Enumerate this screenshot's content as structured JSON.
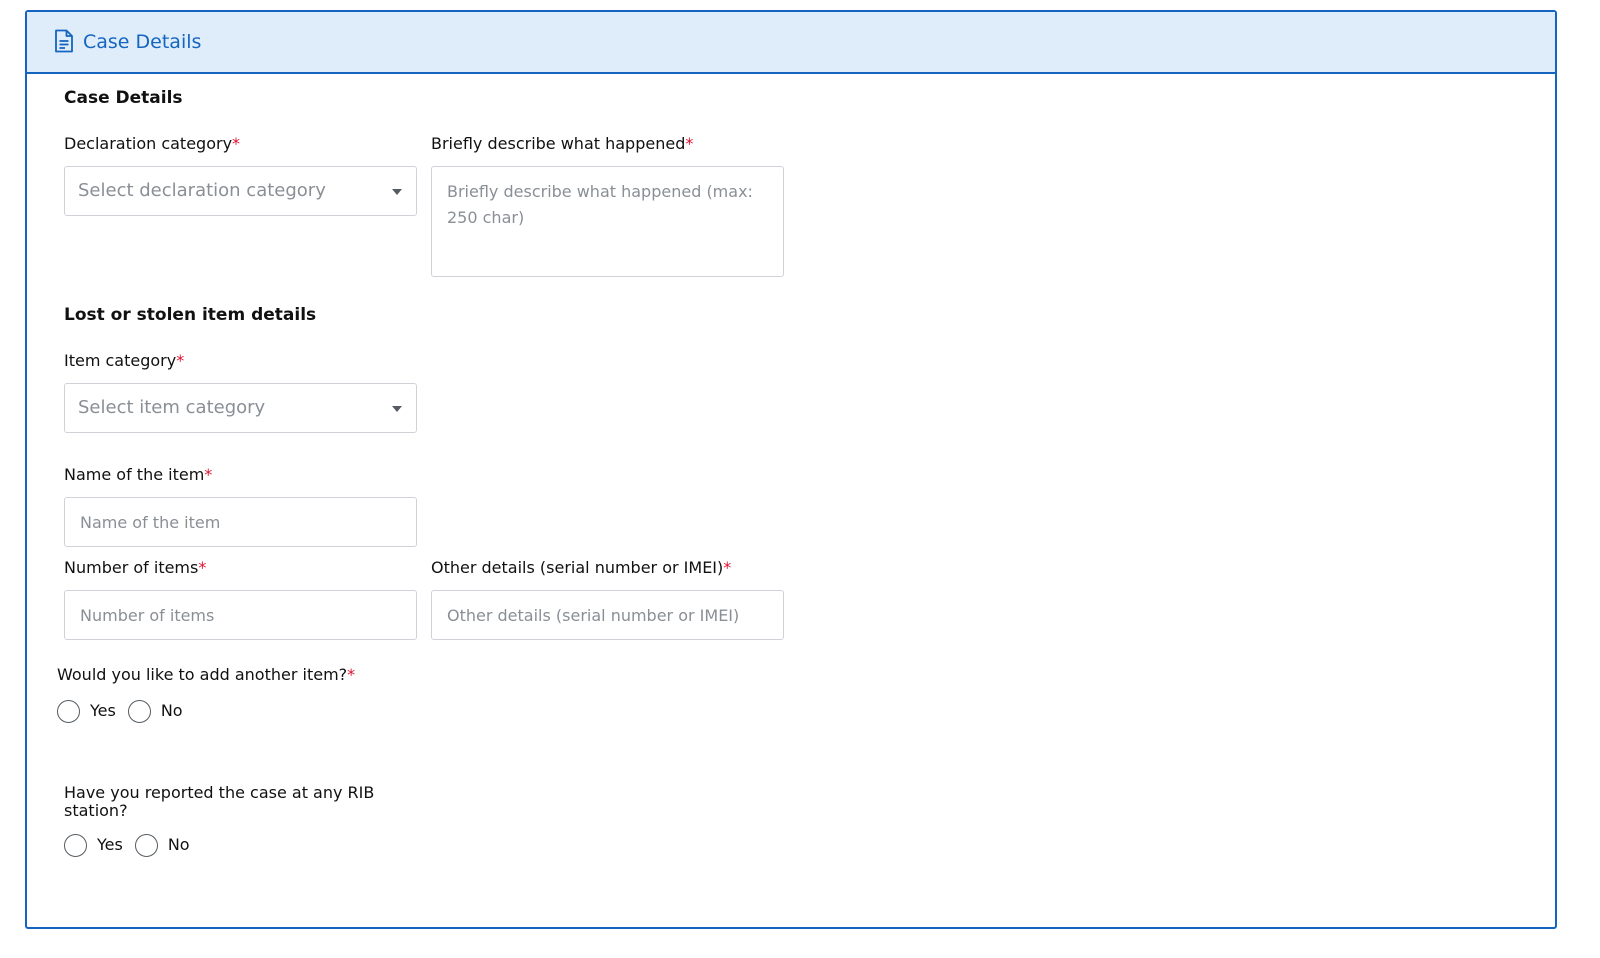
{
  "panel": {
    "header_title": "Case Details",
    "header_icon": "document-icon",
    "accent_color": "#1565c0"
  },
  "case_details": {
    "section_title": "Case Details",
    "declaration_category": {
      "label": "Declaration category",
      "required_mark": "*",
      "placeholder": "Select declaration category"
    },
    "description": {
      "label": "Briefly describe what happened",
      "required_mark": "*",
      "placeholder": "Briefly describe what happened (max: 250 char)"
    }
  },
  "item_details": {
    "section_title": "Lost or stolen item details",
    "item_category": {
      "label": "Item category",
      "required_mark": "*",
      "placeholder": "Select item category"
    },
    "item_name": {
      "label": "Name of the item",
      "required_mark": "*",
      "placeholder": "Name of the item"
    },
    "item_count": {
      "label": "Number of items",
      "required_mark": "*",
      "placeholder": "Number of items"
    },
    "other_details": {
      "label": "Other details (serial number or IMEI)",
      "required_mark": "*",
      "placeholder": "Other details (serial number or IMEI)"
    },
    "add_another": {
      "question": "Would you like to add another item?",
      "required_mark": "*",
      "yes_label": "Yes",
      "no_label": "No"
    }
  },
  "rib_report": {
    "question": "Have you reported the case at any RIB station?",
    "yes_label": "Yes",
    "no_label": "No"
  }
}
